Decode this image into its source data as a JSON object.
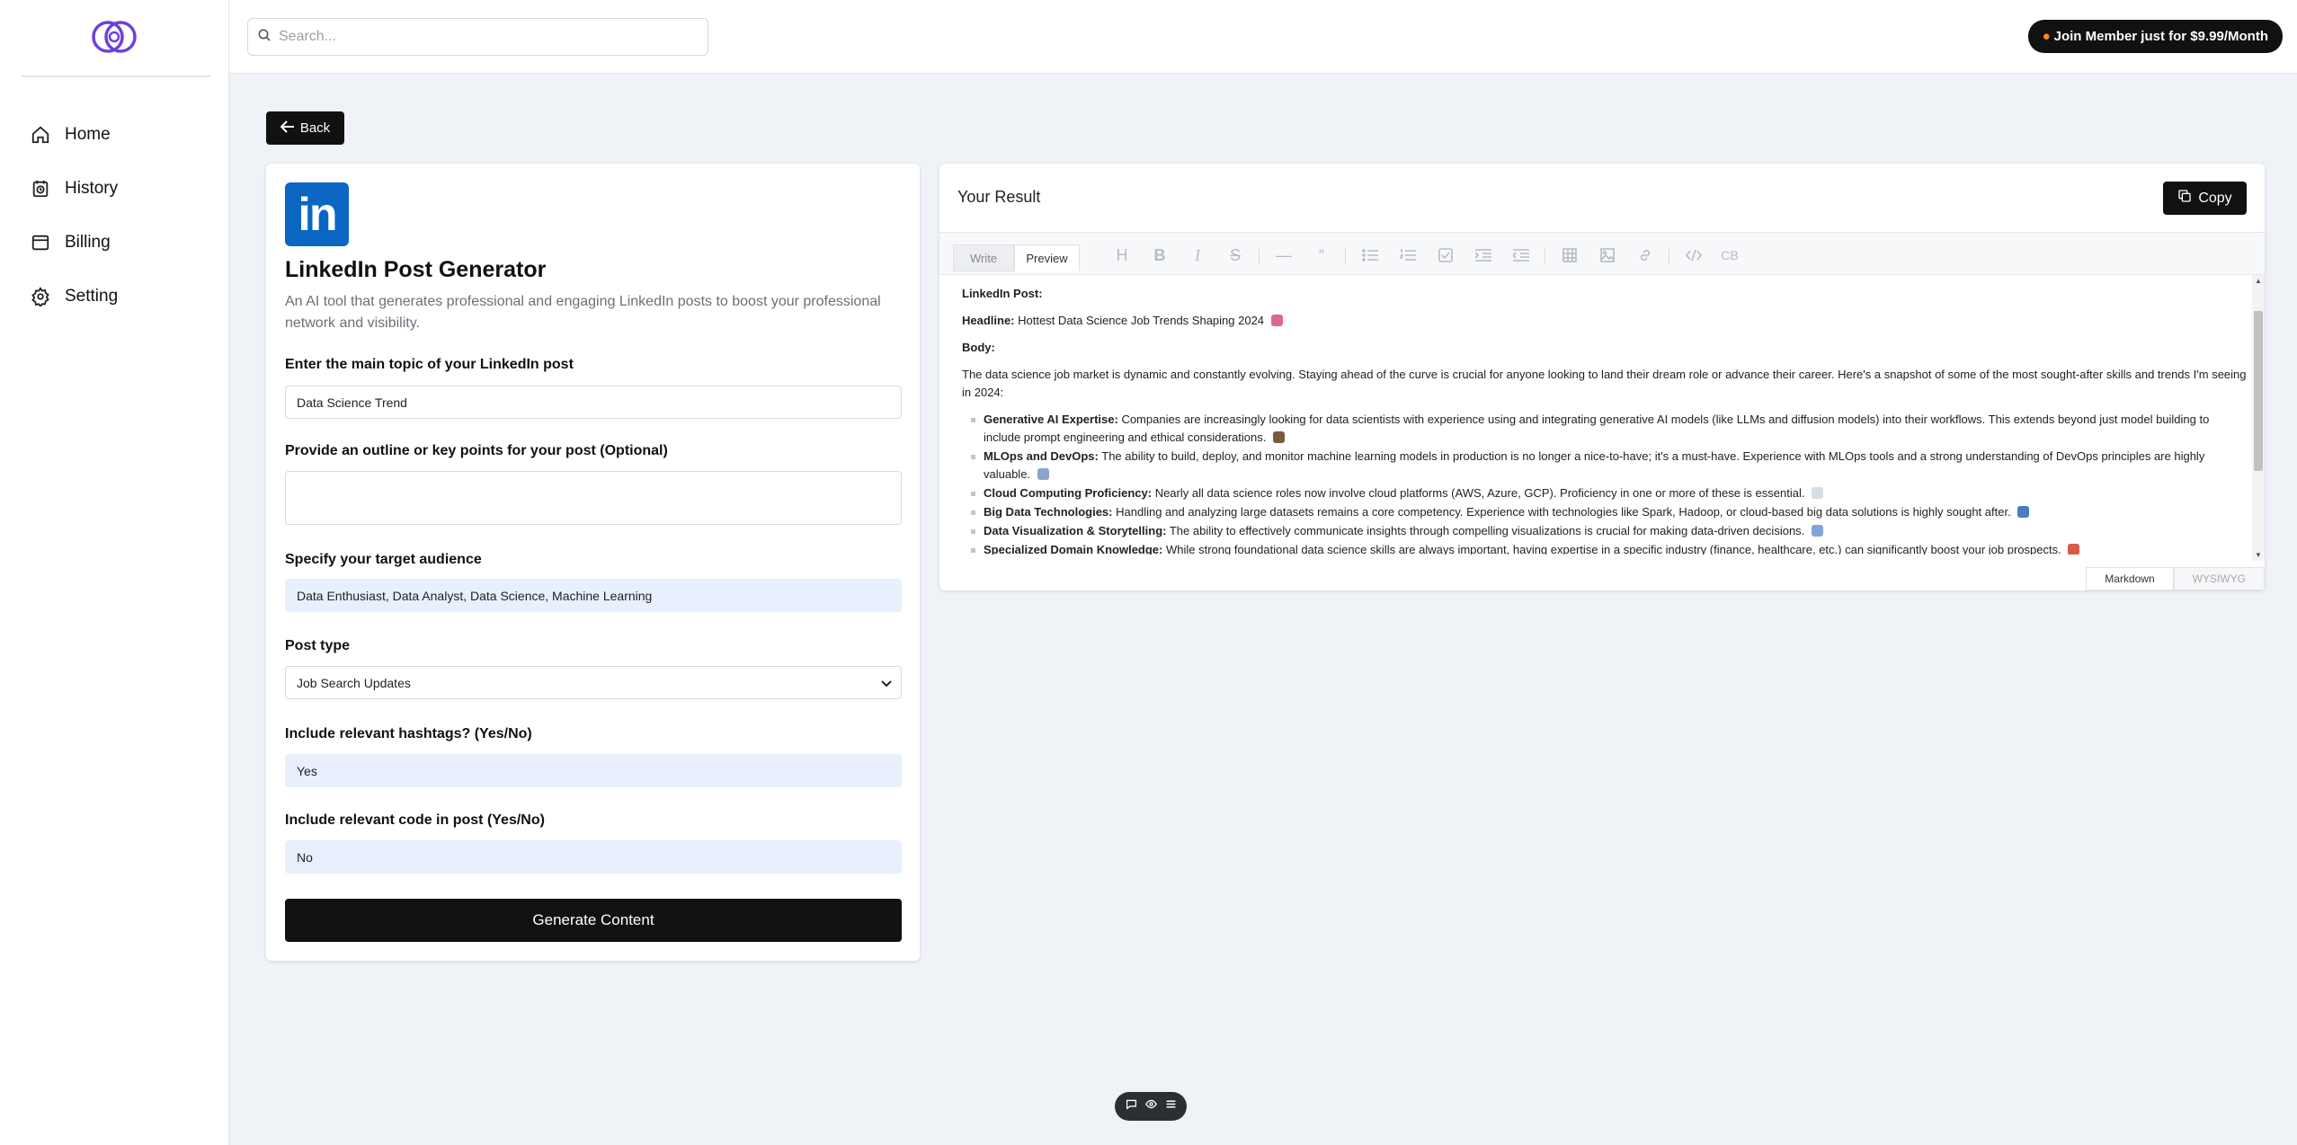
{
  "sidebar": {
    "items": [
      {
        "label": "Home",
        "icon": "home-icon"
      },
      {
        "label": "History",
        "icon": "history-icon"
      },
      {
        "label": "Billing",
        "icon": "billing-icon"
      },
      {
        "label": "Setting",
        "icon": "gear-icon"
      }
    ]
  },
  "header": {
    "search_placeholder": "Search...",
    "join_label": "Join Member just for $9.99/Month"
  },
  "back_label": "Back",
  "form": {
    "logo_text": "in",
    "title": "LinkedIn Post Generator",
    "description": "An AI tool that generates professional and engaging LinkedIn posts to boost your professional network and visibility.",
    "fields": [
      {
        "label": "Enter the main topic of your LinkedIn post",
        "value": "Data Science Trend"
      },
      {
        "label": "Provide an outline or key points for your post (Optional)",
        "value": ""
      },
      {
        "label": "Specify your target audience",
        "value": "Data Enthusiast, Data Analyst, Data Science, Machine Learning"
      },
      {
        "label": "Post type",
        "value": "Job Search Updates"
      },
      {
        "label": "Include relevant hashtags? (Yes/No)",
        "value": "Yes"
      },
      {
        "label": "Include relevant code in post (Yes/No)",
        "value": "No"
      }
    ],
    "generate_label": "Generate Content"
  },
  "result": {
    "title": "Your Result",
    "copy_label": "Copy",
    "tabs": {
      "write": "Write",
      "preview": "Preview"
    },
    "toolbar_icons": [
      "heading-icon",
      "bold-icon",
      "italic-icon",
      "strike-icon",
      "hr-icon",
      "quote-icon",
      "bullet-list-icon",
      "ordered-list-icon",
      "task-icon",
      "indent-icon",
      "outdent-icon",
      "table-icon",
      "image-icon",
      "link-icon",
      "code-icon",
      "codeblock-icon"
    ],
    "toolbar_codeblock_text": "CB",
    "content": {
      "post_label": "LinkedIn Post:",
      "headline_label": "Headline:",
      "headline_text": "Hottest Data Science Job Trends Shaping 2024",
      "body_label": "Body:",
      "intro": "The data science job market is dynamic and constantly evolving. Staying ahead of the curve is crucial for anyone looking to land their dream role or advance their career. Here's a snapshot of some of the most sought-after skills and trends I'm seeing in 2024:",
      "bullets": [
        {
          "title": "Generative AI Expertise:",
          "text": "Companies are increasingly looking for data scientists with experience using and integrating generative AI models (like LLMs and diffusion models) into their workflows. This extends beyond just model building to include prompt engineering and ethical considerations.",
          "emoji_color": "#7a5a3c"
        },
        {
          "title": "MLOps and DevOps:",
          "text": "The ability to build, deploy, and monitor machine learning models in production is no longer a nice-to-have; it's a must-have. Experience with MLOps tools and a strong understanding of DevOps principles are highly valuable.",
          "emoji_color": "#8aa3c9"
        },
        {
          "title": "Cloud Computing Proficiency:",
          "text": "Nearly all data science roles now involve cloud platforms (AWS, Azure, GCP). Proficiency in one or more of these is essential.",
          "emoji_color": "#d7dde6"
        },
        {
          "title": "Big Data Technologies:",
          "text": "Handling and analyzing large datasets remains a core competency. Experience with technologies like Spark, Hadoop, or cloud-based big data solutions is highly sought after.",
          "emoji_color": "#4a7dbf"
        },
        {
          "title": "Data Visualization & Storytelling:",
          "text": "The ability to effectively communicate insights through compelling visualizations is crucial for making data-driven decisions.",
          "emoji_color": "#7fa6d8"
        },
        {
          "title": "Specialized Domain Knowledge:",
          "text": "While strong foundational data science skills are always important, having expertise in a specific industry (finance, healthcare, etc.) can significantly boost your job prospects.",
          "emoji_color": "#d95a4a"
        }
      ]
    },
    "mode_tabs": {
      "markdown": "Markdown",
      "wysiwyg": "WYSIWYG"
    }
  },
  "colors": {
    "accent": "#111111",
    "linkedin": "#0a66c2",
    "logo_purple": "#6d3fe0",
    "filled_input": "#e8f0fe"
  }
}
